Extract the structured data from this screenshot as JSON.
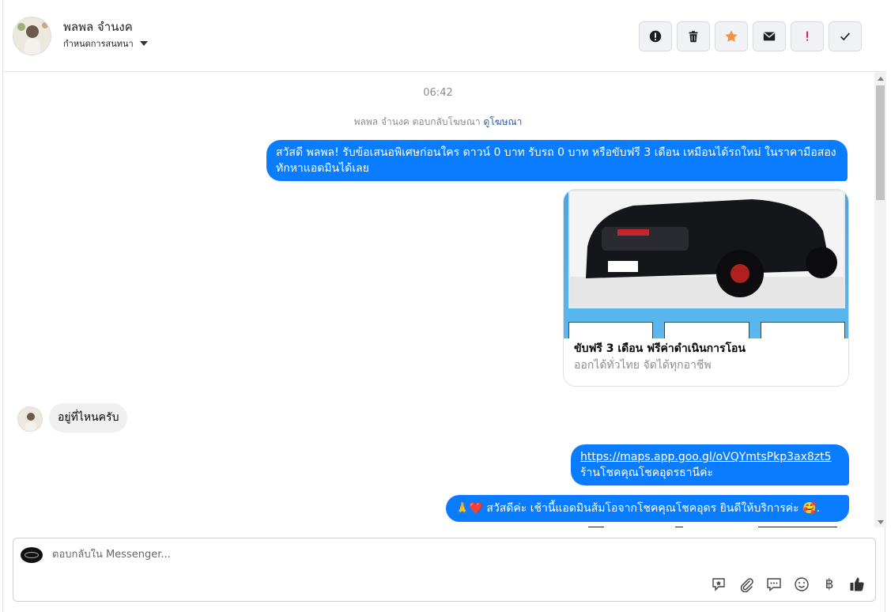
{
  "header": {
    "contact_name": "พลพล จำนงค",
    "conversation_menu": "กำหนดการสนทนา",
    "actions": [
      {
        "name": "report-icon",
        "label": "!"
      },
      {
        "name": "trash-icon"
      },
      {
        "name": "star-icon"
      },
      {
        "name": "mail-icon"
      },
      {
        "name": "important-icon",
        "label": "!"
      },
      {
        "name": "check-icon"
      }
    ]
  },
  "chat": {
    "timestamp": "06:42",
    "ad_reply_prefix": "พลพล จำนงค ตอบกลับโฆษณา",
    "ad_reply_link": "ดูโฆษณา",
    "messages": [
      {
        "text": "สวัสดี พลพล! รับข้อเสนอพิเศษก่อนใคร ดาวน์ 0 บาท รับรถ 0 บาท หรือขับฟรี 3 เดือน เหมือนได้รถใหม่ ในราคามือสอง ทักหาแอดมินได้เลย"
      },
      {
        "text": "อยู่ที่ไหนครับ"
      },
      {
        "link": "https://maps.app.goo.gl/oVQYmtsPkp3ax8zt5",
        "text": "ร้านโชคคุณโชคอุดรธานีค่ะ"
      },
      {
        "text": "🙏❤️ สวัสดีค่ะ เช้านี้แอดมินส้มโอจากโชคคุณโชคอุดร ยินดีให้บริการค่ะ 🥰."
      }
    ],
    "ad_card": {
      "title": "ขับฟรี 3 เดือน ฟรีค่าดำเนินการโอน",
      "subtitle": "ออกได้ทั่วไทย จัดได้ทุกอาชีพ"
    }
  },
  "composer": {
    "placeholder": "ตอบกลับใน Messenger...",
    "value": "",
    "tools": [
      "saved-reply-icon",
      "attachment-icon",
      "chat-bubble-icon",
      "emoji-icon",
      "baht-icon",
      "thumbs-up-icon"
    ],
    "baht_symbol": "฿"
  },
  "colors": {
    "outgoing_bubble": "#0a7cff",
    "incoming_bubble": "#f0f0f0",
    "star": "#f5923e",
    "important": "#e41e3f"
  }
}
